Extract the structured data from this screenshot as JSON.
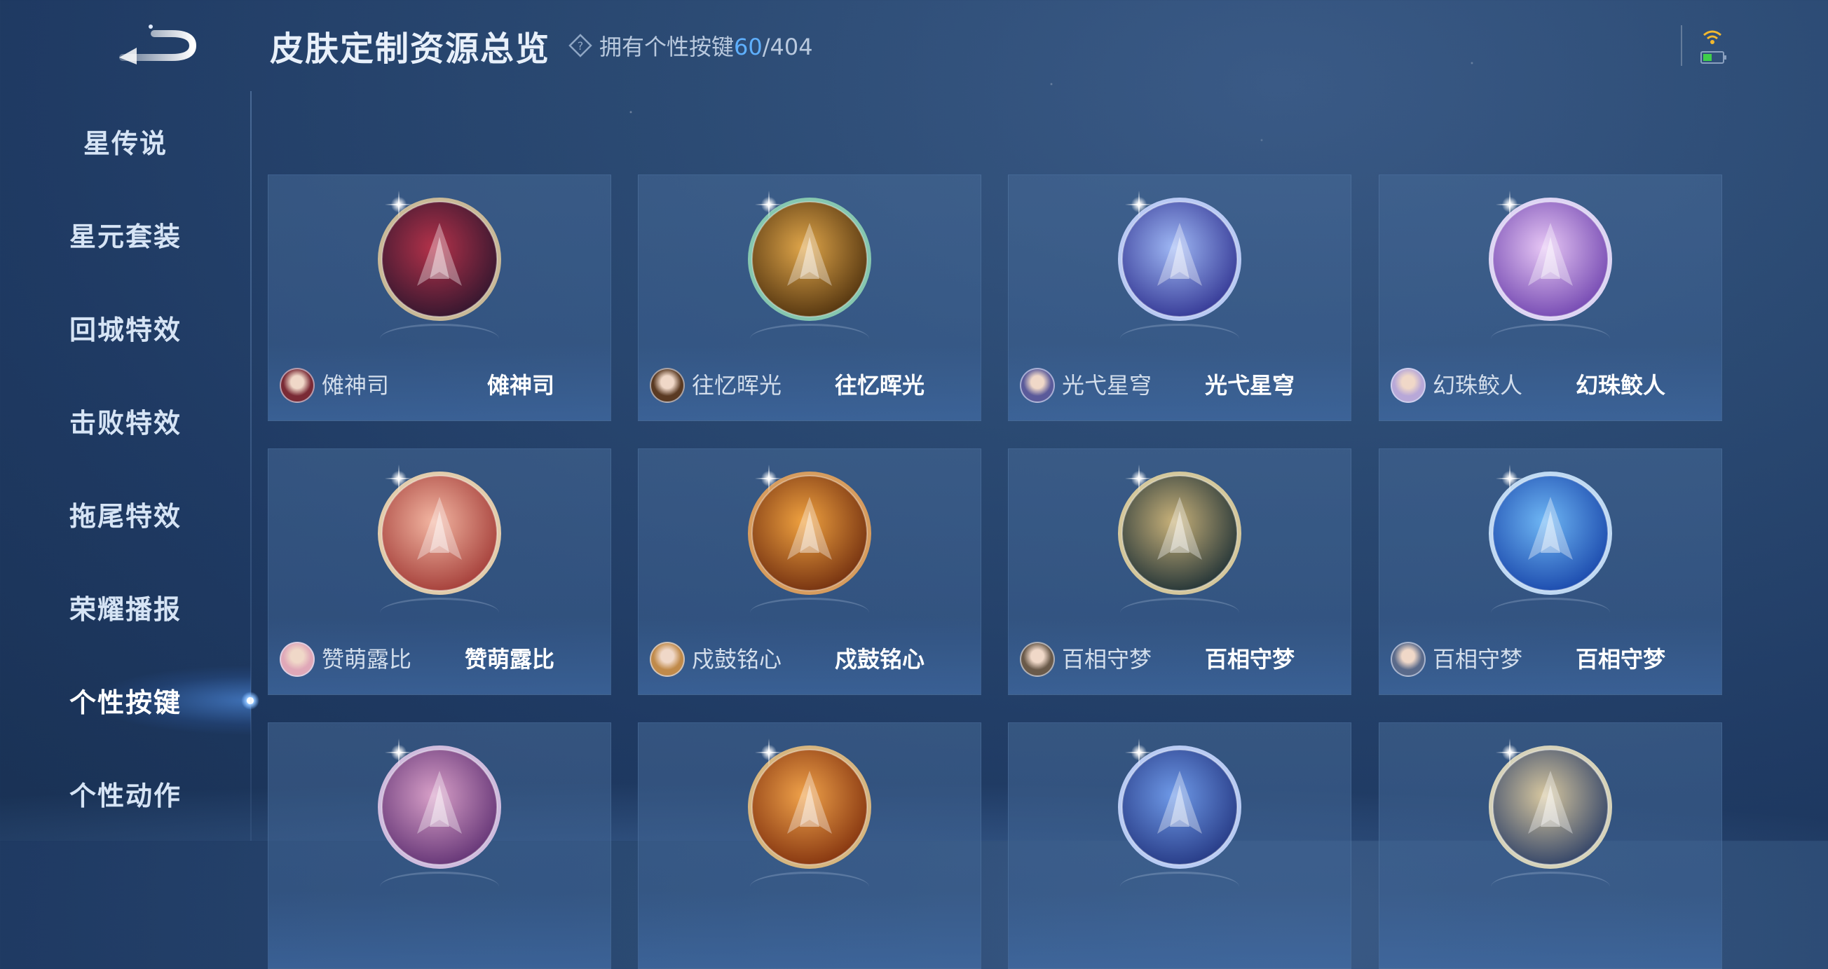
{
  "header": {
    "title": "皮肤定制资源总览",
    "owned_prefix": "拥有个性按键",
    "owned_count": "60",
    "owned_total": "/404"
  },
  "sidebar": {
    "items": [
      {
        "label": "星传说"
      },
      {
        "label": "星元套装"
      },
      {
        "label": "回城特效"
      },
      {
        "label": "击败特效"
      },
      {
        "label": "拖尾特效"
      },
      {
        "label": "荣耀播报"
      },
      {
        "label": "个性按键",
        "active": true
      },
      {
        "label": "个性动作"
      }
    ]
  },
  "cards": [
    {
      "hero": "傩神司",
      "skin": "傩神司",
      "emblem_color": "#b4324a",
      "emblem_dark": "#3a1830",
      "ring": "#d9c49a",
      "avatar": "#7a2a35"
    },
    {
      "hero": "往忆晖光",
      "skin": "往忆晖光",
      "emblem_color": "#e0a64a",
      "emblem_dark": "#5a3a12",
      "ring": "#8fd3b4",
      "avatar": "#5a3a22"
    },
    {
      "hero": "光弋星穹",
      "skin": "光弋星穹",
      "emblem_color": "#9fb8f5",
      "emblem_dark": "#3a3f9a",
      "ring": "#c8d6ff",
      "avatar": "#5a5a9a"
    },
    {
      "hero": "幻珠鲛人",
      "skin": "幻珠鲛人",
      "emblem_color": "#e7c7f5",
      "emblem_dark": "#7a4fb5",
      "ring": "#f0e2ff",
      "avatar": "#b8a8d8"
    },
    {
      "hero": "赞萌露比",
      "skin": "赞萌露比",
      "emblem_color": "#f3b6a2",
      "emblem_dark": "#a8443e",
      "ring": "#f5d9b0",
      "avatar": "#e0a8b8"
    },
    {
      "hero": "戍鼓铭心",
      "skin": "戍鼓铭心",
      "emblem_color": "#f0a240",
      "emblem_dark": "#7a3612",
      "ring": "#e9a45a",
      "avatar": "#c08a4a"
    },
    {
      "hero": "百相守梦",
      "skin": "百相守梦",
      "emblem_color": "#c9b27a",
      "emblem_dark": "#2b3a3a",
      "ring": "#e6d49e",
      "avatar": "#6a5a4a"
    },
    {
      "hero": "百相守梦",
      "skin": "百相守梦",
      "emblem_color": "#6fb7f5",
      "emblem_dark": "#1f4fb0",
      "ring": "#cfe8ff",
      "avatar": "#5a6a8a"
    },
    {
      "hero": "",
      "skin": "",
      "emblem_color": "#d8a0c8",
      "emblem_dark": "#6a3a7a",
      "ring": "#e0c8e8",
      "avatar": ""
    },
    {
      "hero": "",
      "skin": "",
      "emblem_color": "#f0a24a",
      "emblem_dark": "#8a3a12",
      "ring": "#e8c080",
      "avatar": ""
    },
    {
      "hero": "",
      "skin": "",
      "emblem_color": "#6f9ae8",
      "emblem_dark": "#2a3f8a",
      "ring": "#c8d8ff",
      "avatar": ""
    },
    {
      "hero": "",
      "skin": "",
      "emblem_color": "#d8c8a0",
      "emblem_dark": "#3a4a6a",
      "ring": "#e8e0c0",
      "avatar": ""
    }
  ],
  "icons": {
    "back": "back-arrow-icon",
    "help": "question-diamond-icon",
    "wifi": "wifi-icon",
    "battery": "battery-icon"
  },
  "colors": {
    "accent": "#5fb0ff",
    "background": "#24426b",
    "battery": "#3fcf4a",
    "wifi": "#f2b82e"
  }
}
